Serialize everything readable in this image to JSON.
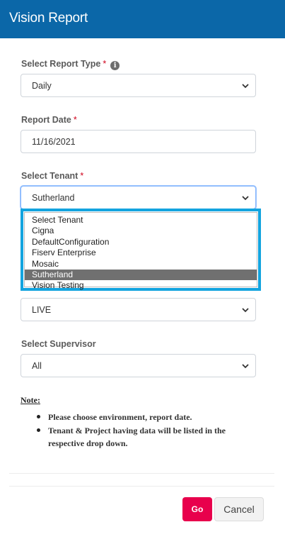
{
  "header": {
    "title": "Vision Report"
  },
  "report_type": {
    "label": "Select Report Type",
    "required_mark": "*",
    "info_icon": "i",
    "value": "Daily"
  },
  "report_date": {
    "label": "Report Date",
    "required_mark": "*",
    "value": "11/16/2021"
  },
  "tenant": {
    "label": "Select Tenant",
    "required_mark": "*",
    "value": "Sutherland",
    "options": [
      "Select Tenant",
      "Cigna",
      "DefaultConfiguration",
      "Fiserv Enterprise",
      "Mosaic",
      "Sutherland",
      "Vision Testing"
    ],
    "selected_index": 5
  },
  "environment": {
    "value": "LIVE"
  },
  "supervisor": {
    "label": "Select Supervisor",
    "value": "All"
  },
  "note": {
    "title": "Note:",
    "items": [
      "Please choose environment, report date.",
      "Tenant & Project having data will be listed in the respective drop down."
    ]
  },
  "footer": {
    "go_label": "Go",
    "cancel_label": "Cancel"
  },
  "colors": {
    "header": "#0b67a8",
    "go_button": "#e8004c",
    "dropdown_highlight": "#13a4df",
    "selected_option": "#707070"
  }
}
